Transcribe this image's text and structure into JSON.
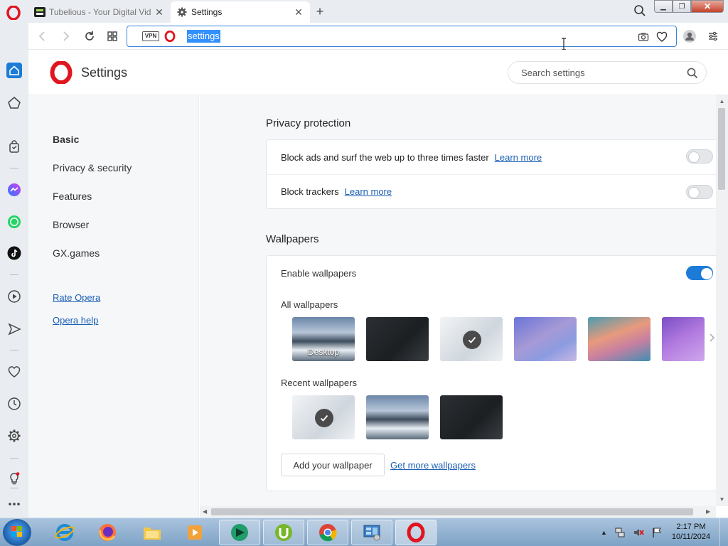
{
  "tabs": [
    {
      "title": "Tubelious - Your Digital Vid",
      "active": false
    },
    {
      "title": "Settings",
      "active": true
    }
  ],
  "address_bar": {
    "vpn_label": "VPN",
    "url": "settings"
  },
  "settings": {
    "header_title": "Settings",
    "search_placeholder": "Search settings",
    "nav": {
      "items": [
        "Basic",
        "Privacy & security",
        "Features",
        "Browser",
        "GX.games"
      ],
      "links": [
        "Rate Opera",
        "Opera help"
      ]
    },
    "privacy": {
      "title": "Privacy protection",
      "rows": [
        {
          "label": "Block ads and surf the web up to three times faster",
          "link": "Learn more",
          "enabled": false
        },
        {
          "label": "Block trackers",
          "link": "Learn more",
          "enabled": false
        }
      ]
    },
    "wallpapers": {
      "title": "Wallpapers",
      "enable_label": "Enable wallpapers",
      "enabled": true,
      "all_label": "All wallpapers",
      "all": [
        {
          "name": "desktop",
          "caption": "Desktop",
          "selected": false
        },
        {
          "name": "dark-curve",
          "caption": "",
          "selected": false
        },
        {
          "name": "light-curve",
          "caption": "",
          "selected": true
        },
        {
          "name": "blue-purple-gradient",
          "caption": "",
          "selected": false
        },
        {
          "name": "orange-teal-gradient",
          "caption": "",
          "selected": false
        },
        {
          "name": "purple-gradient",
          "caption": "",
          "selected": false
        }
      ],
      "recent_label": "Recent wallpapers",
      "recent": [
        {
          "name": "light-curve",
          "selected": true
        },
        {
          "name": "snowy-lake",
          "selected": false
        },
        {
          "name": "dark-curve",
          "selected": false
        }
      ],
      "add_button": "Add your wallpaper",
      "get_more_link": "Get more wallpapers"
    }
  },
  "taskbar": {
    "time": "2:17 PM",
    "date": "10/11/2024"
  },
  "colors": {
    "accent": "#1d7bd8",
    "opera_red": "#e0151f",
    "link": "#1a5fb4"
  }
}
